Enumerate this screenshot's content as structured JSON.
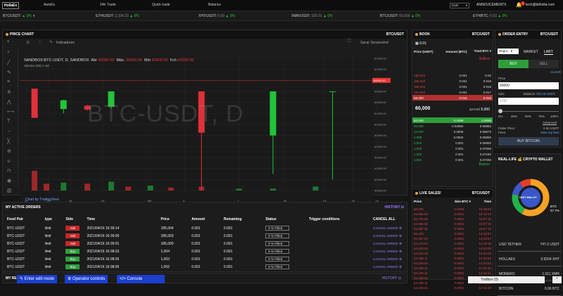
{
  "nav": {
    "logo": "HollaEx",
    "items": [
      "AutoEx",
      "24h Trade",
      "Quick trade",
      "Balance"
    ],
    "theme_select": "Dark",
    "announcements": "ANNOUCEMENTS",
    "notifications": "1",
    "user": "tech@bitholla.com"
  },
  "ticker": [
    {
      "pair": "BTC/USDT:",
      "price": "",
      "change": "0%"
    },
    {
      "pair": "ETH/USDT:",
      "price": "2,334.23",
      "change": "0%"
    },
    {
      "pair": "XHT/USDT:",
      "price": "0.00",
      "change": "0%"
    },
    {
      "pair": "XMR/USDT:",
      "price": "325.01",
      "change": "0%"
    },
    {
      "pair": "BTC/USDT:",
      "price": "60,000",
      "change": "0%"
    },
    {
      "pair": "ETH/BTC:",
      "price": "0.03",
      "change": "0%"
    }
  ],
  "chart": {
    "title": "PRICE CHART",
    "pair": "BTC/USDT",
    "interval": "D",
    "indicators": "Indicadores",
    "screenshot": "Sacar Screenshot",
    "symbol": "SANDBOX:BTC-USDT, D, SANDBOX",
    "abr_label": "Abr",
    "abr": "60000.00",
    "max_label": "Máx.",
    "max": "60000.00",
    "min_label": "Mín",
    "min": "60000.00",
    "fch_label": "Fch",
    "fch": "60000.00",
    "volume": "Volume (20)",
    "vol_val": "0",
    "vol_na": "n/d",
    "watermark": "BTC-USDT, D",
    "tv": "Chart by TradingView",
    "price_tag": "60000.00",
    "bottom_left": [
      "5m",
      "1h",
      "1d",
      "6 para..."
    ],
    "bottom_right": [
      "11:56:49 (UTC)",
      "%",
      "log",
      "Logarítmica",
      "auto"
    ]
  },
  "chart_data": {
    "type": "candlestick",
    "y_ticks": [
      "64000.00",
      "62000.00",
      "60000.00",
      "58000.00",
      "56000.00",
      "54000.00",
      "52000.00",
      "50000.00",
      "48000.00",
      "46000.00",
      "44000.00",
      "42000.00",
      "40000.00"
    ],
    "x_ticks": [
      "23",
      "25",
      "26",
      "29",
      "Abr",
      "4",
      "7",
      "10",
      "13",
      "16",
      "19"
    ],
    "ylim": [
      40000,
      64000
    ],
    "candles": [
      {
        "x": 0.5,
        "o": 58500,
        "c": 53200,
        "h": 58500,
        "l": 53200
      },
      {
        "x": 2.2,
        "o": 54800,
        "c": 56400,
        "h": 56500,
        "l": 54000
      },
      {
        "x": 3.6,
        "o": 55400,
        "c": 54700,
        "h": 55600,
        "l": 54500
      },
      {
        "x": 5.0,
        "o": 55200,
        "c": 58000,
        "h": 58000,
        "l": 54900
      },
      {
        "x": 10.3,
        "o": 58000,
        "c": 50500,
        "h": 58000,
        "l": 40000
      },
      {
        "x": 14.5,
        "o": 50000,
        "c": 58000,
        "h": 58000,
        "l": 43000
      },
      {
        "x": 18.0,
        "o": 58000,
        "c": 58000,
        "h": 58000,
        "l": 42000
      }
    ],
    "volume": [
      {
        "x": 0.5,
        "v": 1.0,
        "up": false
      },
      {
        "x": 1.2,
        "v": 0.35,
        "up": false
      },
      {
        "x": 2.2,
        "v": 0.4,
        "up": true
      },
      {
        "x": 3.6,
        "v": 0.35,
        "up": false
      },
      {
        "x": 5.0,
        "v": 0.45,
        "up": true
      },
      {
        "x": 6.0,
        "v": 0.2,
        "up": false
      },
      {
        "x": 7.3,
        "v": 0.25,
        "up": true
      },
      {
        "x": 8.5,
        "v": 0.15,
        "up": false
      },
      {
        "x": 10.3,
        "v": 0.2,
        "up": false
      },
      {
        "x": 12.5,
        "v": 0.1,
        "up": true
      },
      {
        "x": 14.5,
        "v": 0.1,
        "up": true
      },
      {
        "x": 17.0,
        "v": 0.2,
        "up": true
      }
    ]
  },
  "book": {
    "title": "BOOK",
    "pair": "BTC/USDT",
    "step": "0.01",
    "headers": [
      "Price (USDT)",
      "Amount (BTC)",
      "Total"
    ],
    "total_unit": "BTC",
    "sellers_label": "Sellers",
    "buyers_label": "Buyers",
    "mid": "60,000",
    "spread_label": "spread",
    "spread": "5,000",
    "asks": [
      [
        "185,004",
        "0.001",
        "0.02"
      ],
      [
        "185,003",
        "0.001",
        "0.019"
      ],
      [
        "185,000",
        "0.001",
        "0.018"
      ],
      [
        "120,000",
        "0.001",
        "0.017"
      ],
      [
        "65,000",
        "0.016",
        "0.016"
      ]
    ],
    "bids": [
      [
        "60,000",
        "0.0099",
        "0.0099"
      ],
      [
        "50,000",
        "0.04892",
        "0.05882"
      ],
      [
        "42,000",
        "0.0005",
        "0.05872"
      ],
      [
        "4,999",
        "0.0002",
        "0.06892"
      ],
      [
        "1,004",
        "0.001",
        "0.06992"
      ],
      [
        "1,003",
        "0.001",
        "0.07092"
      ],
      [
        "1,002",
        "0.001",
        "0.07192"
      ],
      [
        "1,001",
        "0.001",
        "0.07292"
      ]
    ]
  },
  "entry": {
    "title": "ORDER ENTRY",
    "pair": "BTC/USDT",
    "regular": "Regul...",
    "market": "MARKET",
    "limit": "LIMIT",
    "buy": "BUY",
    "sell": "SELL",
    "clear": "CLEAR",
    "price_label": "Price",
    "price_value": "60000",
    "size_label": "Size",
    "balance_label": "Balance",
    "balance_value": "750.19 USDT",
    "size_placeholder": "0.00",
    "pcts": [
      "0%",
      "25%",
      "50%",
      "75%",
      "100%"
    ],
    "advanced": "Advanced",
    "order_price_label": "Order Price:",
    "order_price_value": "0.00 USDT",
    "fees_label": "Fees:",
    "fees_value": "View my fees",
    "buy_btn": "BUY BITCOIN"
  },
  "wallet": {
    "title": "REAL-LIFE 💰 CRYPTO WALLET",
    "center": "BTC 57.7%",
    "inner_label": "USDT WALLET",
    "rows": [
      [
        "USD TETHER",
        "747.2 USDT"
      ],
      [
        "HOLLAEX",
        "9.9334 XHT"
      ],
      [
        "MONERO",
        "1.011 XMR"
      ],
      [
        "BITCOIN",
        "0.06 BTC"
      ]
    ],
    "donut": [
      {
        "label": "BTC",
        "value": 57.7,
        "color": "#f5a225"
      },
      {
        "label": "USDT",
        "value": 20,
        "color": "#21b24a"
      },
      {
        "label": "XHT",
        "value": 12,
        "color": "#3a57c9"
      },
      {
        "label": "XMR",
        "value": 10.3,
        "color": "#e2402b"
      }
    ]
  },
  "live": {
    "title": "LIVE SALES!",
    "pair": "BTC/USDT",
    "headers": [
      "Price",
      "Size",
      "Time"
    ],
    "size_unit": "BTC",
    "rows": [
      [
        "60,000",
        "0.0005",
        "15:19:02"
      ],
      [
        "64,066.52",
        "0.0001",
        "15:13:13"
      ],
      [
        "62,750.65",
        "0.0001",
        "15:07:25"
      ],
      [
        "64,066.52",
        "0.0001",
        "15:07:25"
      ],
      [
        "64,387.01",
        "0.0001",
        "15:07:15"
      ],
      [
        "60,000",
        "0.0001",
        "14:43:57"
      ],
      [
        "64,387.01",
        "0.0001",
        "14:43:57"
      ],
      [
        "64,123.52",
        "0.0001",
        "14:43:18"
      ],
      [
        "64,423.45",
        "0.0001",
        "14:43:08"
      ],
      [
        "64,428.53",
        "0.0001",
        "14:43:04"
      ],
      [
        "64,438.11",
        "0.0001",
        "14:42:58"
      ],
      [
        "64,428.53",
        "0.0001",
        "14:42:52"
      ],
      [
        "64,438.11",
        "0.0001",
        "14:42:49"
      ],
      [
        "64,438.11",
        "0.0001",
        "14:42:41"
      ],
      [
        "64,438.54",
        "0.0001",
        "14:42:37"
      ],
      [
        "64,438.11",
        "0.0001",
        "14:42:34"
      ],
      [
        "64,438.54",
        "0.0001",
        "14:42:33"
      ]
    ]
  },
  "orders": {
    "title": "MY ACTIVE ORDERS",
    "history": "HISTORY",
    "cancel_all": "CANCEL ALL",
    "headers": [
      "Food Pair",
      "type",
      "Side",
      "Time",
      "Price",
      "Amount",
      "Remaining",
      "Status",
      "Trigger conditions"
    ],
    "rows": [
      [
        "BTC-USDT",
        "limit",
        "Sell",
        "2021/04/16 16:39:14",
        "185,004",
        "0.001",
        "0.001",
        "0 % Filled",
        "",
        "CANCEL ORDER"
      ],
      [
        "BTC-USDT",
        "limit",
        "Sell",
        "2021/04/16 16:39:09",
        "185,003",
        "0.001",
        "0.001",
        "0 % Filled",
        "",
        "CANCEL ORDER"
      ],
      [
        "BTC-USDT",
        "limit",
        "Sell",
        "2021/04/16 16:39:01",
        "185,000",
        "0.001",
        "0.001",
        "0 % Filled",
        "",
        "CANCEL ORDER"
      ],
      [
        "BTC-USDT",
        "limit",
        "Buy",
        "2021/04/16 16:38:33",
        "1,004",
        "0.001",
        "0.001",
        "0 % Filled",
        "",
        "CANCEL ORDER"
      ],
      [
        "BTC-USDT",
        "limit",
        "Buy",
        "2021/04/16 16:38:26",
        "1,003",
        "0.001",
        "0.001",
        "0 % Filled",
        "",
        "CANCEL ORDER"
      ],
      [
        "BTC-USDT",
        "limit",
        "Buy",
        "2021/04/16 16:38:05",
        "1,002",
        "0.001",
        "0.001",
        "0 % Filled",
        "",
        "CANCEL ORDER"
      ]
    ],
    "next_title": "MY RE",
    "next_history": "HISTORY"
  },
  "bottom": {
    "edit": "✎ Enter edit mode",
    "operator": "⚙ Operator controls",
    "console": "</> Console",
    "trollbox": "Trollbox (0)"
  }
}
